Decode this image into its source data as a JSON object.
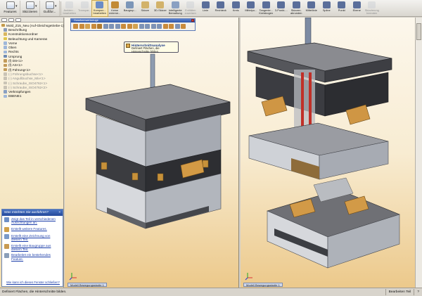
{
  "toolbar": {
    "dropdowns": [
      {
        "label": "Features",
        "icon": "features-icon"
      },
      {
        "label": "Skizzieren",
        "icon": "sketch-icon"
      },
      {
        "label": "Gußfor...",
        "icon": "mold-tools-icon"
      }
    ],
    "buttons": [
      {
        "label": "Ambien...\nbearbeiten",
        "icon": "ambient-icon",
        "disabled": true,
        "active": false,
        "color": "#c7cbd3"
      },
      {
        "label": "Transpar...",
        "icon": "transparency-icon",
        "disabled": true,
        "active": false,
        "color": "#c7cbd3"
      },
      {
        "label": "Kompon...\nbearbeiten",
        "icon": "edit-component-icon",
        "disabled": false,
        "active": true,
        "color": "#6b8cc6"
      },
      {
        "label": "Keine\nexterne...",
        "icon": "no-external-icon",
        "disabled": false,
        "active": false,
        "color": "#c28a35"
      },
      {
        "label": "Baugrup...",
        "icon": "assembly-icon",
        "disabled": false,
        "active": false,
        "color": "#7c96b8"
      },
      {
        "label": "Skizze",
        "icon": "sketch2-icon",
        "disabled": false,
        "active": false,
        "color": "#d2b26a"
      },
      {
        "label": "3D-Skizze",
        "icon": "3d-sketch-icon",
        "disabled": false,
        "active": false,
        "color": "#d2b26a"
      },
      {
        "label": "Intelligente\nBemaßung",
        "icon": "smart-dimension-icon",
        "disabled": false,
        "active": false,
        "color": "#8aa0c2"
      },
      {
        "label": "Entitäten\nzuweisen",
        "icon": "convert-entities-icon",
        "disabled": true,
        "active": false,
        "color": "#c7cbd3"
      },
      {
        "label": "Linie",
        "icon": "line-icon",
        "disabled": false,
        "active": false,
        "color": "#5a6e9a"
      },
      {
        "label": "Rechteck",
        "icon": "rectangle-icon",
        "disabled": false,
        "active": false,
        "color": "#5a6e9a"
      },
      {
        "label": "Kreis",
        "icon": "circle-icon",
        "disabled": false,
        "active": false,
        "color": "#5a6e9a"
      },
      {
        "label": "Mittelpu...",
        "icon": "centerpoint-arc-icon",
        "disabled": false,
        "active": false,
        "color": "#5a6e9a"
      },
      {
        "label": "Tangente...\nKreisbogen",
        "icon": "tangent-arc-icon",
        "disabled": false,
        "active": false,
        "color": "#5a6e9a"
      },
      {
        "label": "3-Punkt-...",
        "icon": "3-point-arc-icon",
        "disabled": false,
        "active": false,
        "color": "#5a6e9a"
      },
      {
        "label": "Skizzen-\nabrunden",
        "icon": "sketch-fillet-icon",
        "disabled": false,
        "active": false,
        "color": "#5a6e9a"
      },
      {
        "label": "Mittellinie",
        "icon": "centerline-icon",
        "disabled": false,
        "active": false,
        "color": "#5a6e9a"
      },
      {
        "label": "Spline",
        "icon": "spline-icon",
        "disabled": false,
        "active": false,
        "color": "#5a6e9a"
      },
      {
        "label": "Punkt",
        "icon": "point-icon",
        "disabled": false,
        "active": false,
        "color": "#5a6e9a"
      },
      {
        "label": "Ebene",
        "icon": "plane-icon",
        "disabled": false,
        "active": false,
        "color": "#5a6e9a"
      },
      {
        "label": "Skizzierung\nbeenden",
        "icon": "exit-sketch-icon",
        "disabled": true,
        "active": false,
        "color": "#c7cbd3"
      }
    ]
  },
  "tree": {
    "items": [
      {
        "label": "Mold_Z15_Neu (Auf-Gleichsgetriebe-1)",
        "icon": "assembly-icon",
        "color": "#c49a4a",
        "ghost": false,
        "indent": 0
      },
      {
        "label": "Beschriftung",
        "icon": "annotation-icon",
        "color": "#8a9bb8",
        "ghost": false,
        "indent": 1
      },
      {
        "label": "Konstruktionsordner",
        "icon": "design-folder-icon",
        "color": "#d8b65e",
        "ghost": false,
        "indent": 1
      },
      {
        "label": "Beleuchtung und Kameras",
        "icon": "lights-icon",
        "color": "#e0c64a",
        "ghost": false,
        "indent": 1
      },
      {
        "label": "Vorne",
        "icon": "plane-icon",
        "color": "#9fb7d9",
        "ghost": false,
        "indent": 1
      },
      {
        "label": "Oben",
        "icon": "plane-icon",
        "color": "#9fb7d9",
        "ghost": false,
        "indent": 1
      },
      {
        "label": "Rechts",
        "icon": "plane-icon",
        "color": "#9fb7d9",
        "ghost": false,
        "indent": 1
      },
      {
        "label": "Ursprung",
        "icon": "origin-icon",
        "color": "#6e8bb3",
        "ghost": false,
        "indent": 1
      },
      {
        "label": "(f) DS<1>",
        "icon": "part-icon",
        "color": "#c29b5a",
        "ghost": false,
        "indent": 1
      },
      {
        "label": "(f) AS<1>",
        "icon": "part-icon",
        "color": "#c29b5a",
        "ghost": false,
        "indent": 1
      },
      {
        "label": "(f) Führung<1>",
        "icon": "part-icon",
        "color": "#c29b5a",
        "ghost": false,
        "indent": 1
      },
      {
        "label": "(-) Führungsbuchse<1>",
        "icon": "part-icon",
        "color": "#c9c3b5",
        "ghost": true,
        "indent": 1
      },
      {
        "label": "(-) Angußbuchse_Mix<1>",
        "icon": "part-icon",
        "color": "#c9c3b5",
        "ghost": true,
        "indent": 1
      },
      {
        "label": "(-) Schraube_ISO4762<1>",
        "icon": "part-icon",
        "color": "#c9c3b5",
        "ghost": true,
        "indent": 1
      },
      {
        "label": "(-) Schraube_ISO4762<2>",
        "icon": "part-icon",
        "color": "#c9c3b5",
        "ghost": true,
        "indent": 1
      },
      {
        "label": "Verknüpfungen",
        "icon": "mates-icon",
        "color": "#8aa0c2",
        "ghost": false,
        "indent": 1
      },
      {
        "label": "EBENE1",
        "icon": "plane-icon",
        "color": "#9fb7d9",
        "ghost": false,
        "indent": 1
      }
    ]
  },
  "help": {
    "title": "Was möchten Sie ausführen?",
    "items": [
      {
        "label": "Zeigt das Teil in verschiedenen Ausrichtungen an.",
        "icon": "orientation-icon",
        "color": "#6d8fc7"
      },
      {
        "label": "Erstellt weitere Features.",
        "icon": "features-icon",
        "color": "#d0a049"
      },
      {
        "label": "Erstellt eine Zeichnung von diesem Teil.",
        "icon": "drawing-icon",
        "color": "#7a9ac8"
      },
      {
        "label": "Erstellt eine Baugruppe aus diesem Teil.",
        "icon": "assembly-icon",
        "color": "#c89a52"
      },
      {
        "label": "Bearbeitet ein bestehendes Feature.",
        "icon": "edit-feature-icon",
        "color": "#8a9eb8"
      }
    ],
    "close_link": "Wie kann ich dieses Fenster schließen?"
  },
  "view_toolbar": {
    "title": "Gussformwerkzeuge",
    "icons": [
      {
        "icon": "parting-line-icon",
        "color": "#c98b3b"
      },
      {
        "icon": "shutoff-icon",
        "color": "#c98b3b"
      },
      {
        "icon": "scale-icon",
        "color": "#d3a24f"
      },
      {
        "icon": "draft-analysis-icon",
        "color": "#c98b3b"
      },
      {
        "icon": "undercut-icon",
        "color": "#b07a2e"
      },
      {
        "icon": "parting-surface-icon",
        "color": "#7e93b6"
      },
      {
        "icon": "ruled-surface-icon",
        "color": "#7e93b6"
      },
      {
        "icon": "tooling-split-icon",
        "color": "#7e93b6"
      },
      {
        "icon": "core-icon",
        "color": "#c98b3b"
      },
      {
        "icon": "cavity-icon",
        "color": "#c98b3b"
      },
      {
        "icon": "mold-folder-icon",
        "color": "#d3a24f"
      },
      {
        "icon": "surface-icon",
        "color": "#7e93b6"
      },
      {
        "icon": "delete-face-icon",
        "color": "#7e93b6"
      },
      {
        "icon": "offset-icon",
        "color": "#7e93b6"
      },
      {
        "icon": "knit-icon",
        "color": "#7e93b6"
      },
      {
        "icon": "interlock-icon",
        "color": "#c98b3b"
      },
      {
        "icon": "split-icon",
        "color": "#c98b3b"
      },
      {
        "icon": "core-side-icon",
        "color": "#7e93b6"
      },
      {
        "icon": "mold-setup-icon",
        "color": "#c98b3b"
      }
    ]
  },
  "tooltip": {
    "title": "Hinterschnittsanalyse",
    "description": "Definiert Flächen, die Hinterschnitte bilden."
  },
  "left_view": {
    "tab_label": "Modell  Bewegungsstudie 1"
  },
  "right_view": {
    "tab_label": "Modell  Bewegungsstudie 1"
  },
  "status": {
    "message": "Definiert Flächen, die Hinterschnitte bilden.",
    "mode": "Bearbeiten Teil"
  }
}
